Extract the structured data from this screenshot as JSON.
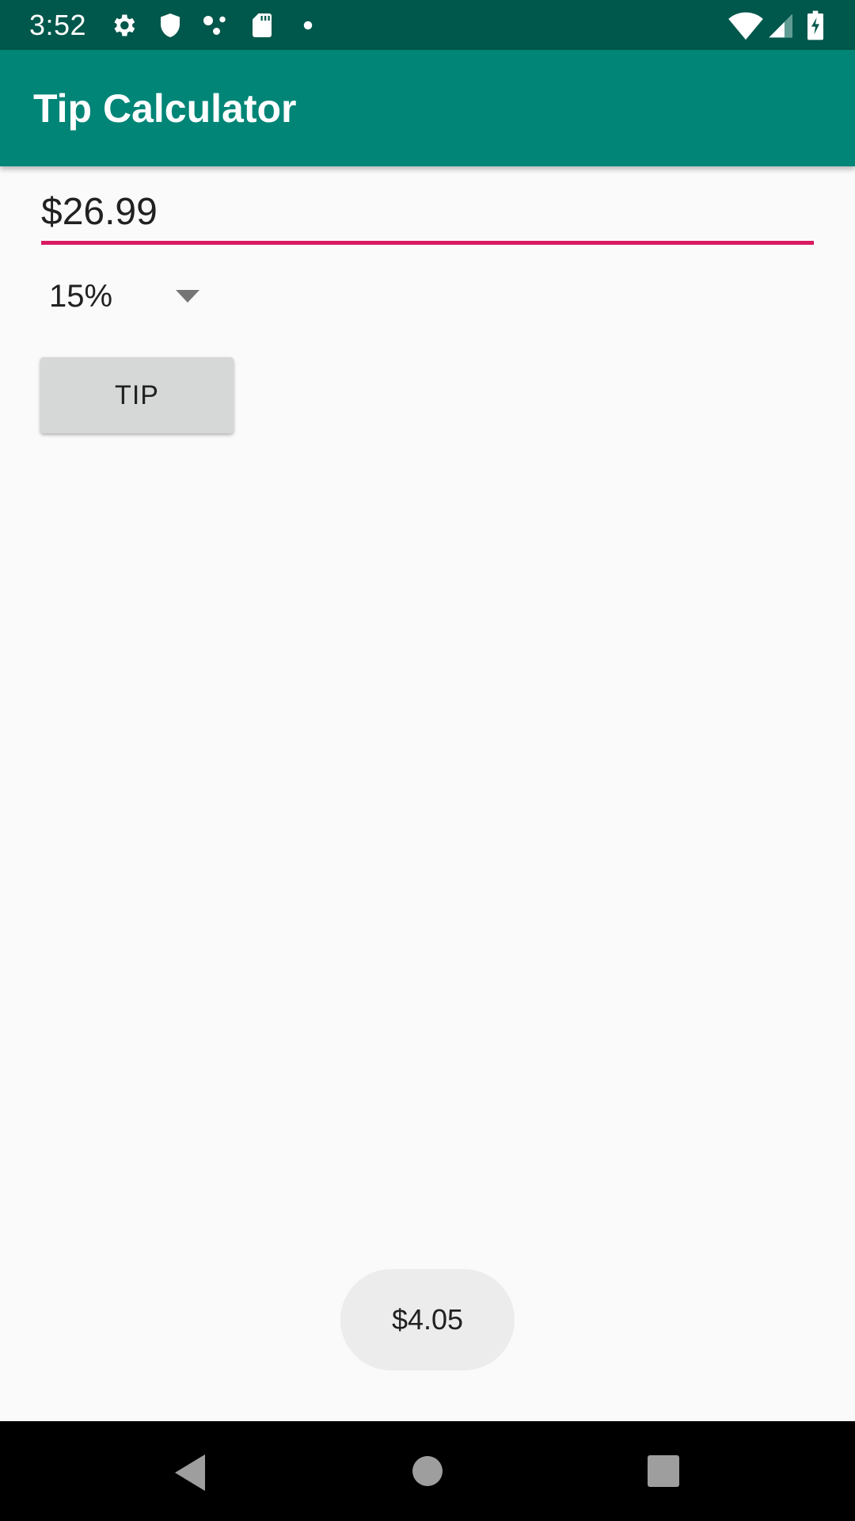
{
  "status_bar": {
    "time": "3:52",
    "icons_left": [
      "gear-icon",
      "shield-icon",
      "dots-icon",
      "sd-card-icon",
      "notification-dot-icon"
    ],
    "icons_right": [
      "wifi-icon",
      "cellular-signal-icon",
      "battery-charging-icon"
    ],
    "background": "#00574b"
  },
  "app_bar": {
    "title": "Tip Calculator",
    "background": "#008577"
  },
  "bill_input": {
    "value": "$26.99",
    "underline_color": "#d81b60"
  },
  "tip_spinner": {
    "selected": "15%"
  },
  "tip_button": {
    "label": "TIP"
  },
  "toast": {
    "message": "$4.05"
  },
  "nav_bar": {
    "buttons": [
      "back-icon",
      "home-icon",
      "recents-icon"
    ]
  }
}
